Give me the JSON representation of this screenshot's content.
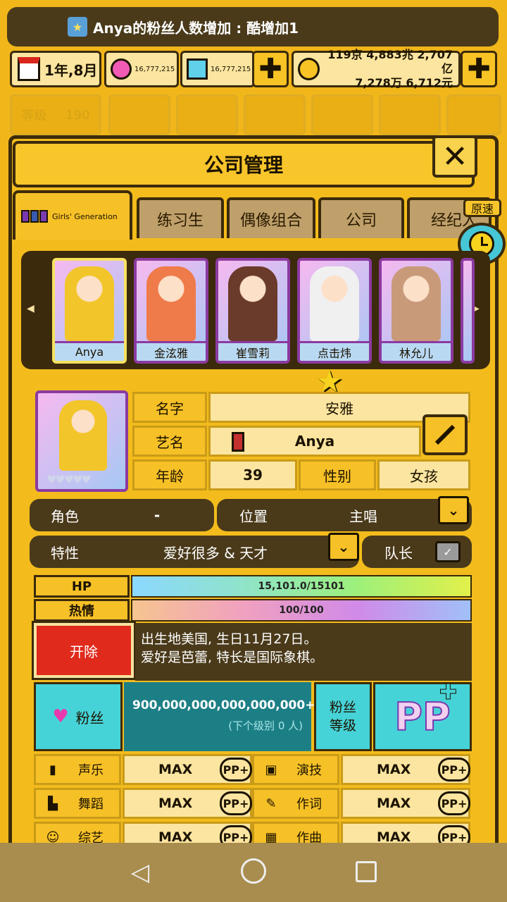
{
  "notification": {
    "text": "Anya的粉丝人数增加 : 酷增加1"
  },
  "status": {
    "date": "1年,8月",
    "pink_gems": "16,777,215",
    "blue_gems": "16,777,215",
    "money_line1": "119京 4,883兆 2,707亿",
    "money_line2": "7,278万 6,712元"
  },
  "background_menu": {
    "level_label": "等级",
    "level_value": "190"
  },
  "window": {
    "title": "公司管理"
  },
  "tabs": {
    "group_name": "Girls' Generation",
    "items": [
      "练习生",
      "偶像组合",
      "公司",
      "经纪人"
    ]
  },
  "speed": {
    "label": "原速"
  },
  "members": [
    {
      "name": "Anya",
      "hair": "#f2c52a",
      "outfit": "#f79a3a"
    },
    {
      "name": "金泫雅",
      "hair": "#ef7a4a",
      "outfit": "#f6d6c0"
    },
    {
      "name": "崔雪莉",
      "hair": "#6a3a2a",
      "outfit": "#d64a7a"
    },
    {
      "name": "点击",
      "hair": "#f0f0f0",
      "outfit": "#222222",
      "name_suffix": "炜"
    },
    {
      "name": "林允儿",
      "hair": "#c89a7a",
      "outfit": "#f2b6c8"
    }
  ],
  "profile": {
    "name_label": "名字",
    "name_value": "安雅",
    "stage_label": "艺名",
    "stage_value": "Anya",
    "age_label": "年龄",
    "age_value": "39",
    "gender_label": "性别",
    "gender_value": "女孩",
    "role_label": "角色",
    "role_value": "-",
    "position_label": "位置",
    "position_value": "主唱",
    "trait_label": "特性",
    "trait_value": "爱好很多 & 天才",
    "leader_label": "队长"
  },
  "bars": {
    "hp_label": "HP",
    "hp_text": "15,101.0/15101",
    "hp_fraction": 1.0,
    "passion_label": "热情",
    "passion_text": "100/100",
    "passion_fraction": 1.0
  },
  "fire_button": "开除",
  "bio": {
    "line1": "出生地美国, 生日11月27日。",
    "line2": "爱好是芭蕾, 特长是国际象棋。"
  },
  "fans": {
    "label": "粉丝",
    "count": "900,000,000,000,000,000+ 人",
    "next": "(下个级别 0 人)",
    "level_label": "粉丝\n等级"
  },
  "skills": [
    {
      "name": "声乐",
      "value": "MAX",
      "pp": "PP+"
    },
    {
      "name": "演技",
      "value": "MAX",
      "pp": "PP+"
    },
    {
      "name": "舞蹈",
      "value": "MAX",
      "pp": "PP+"
    },
    {
      "name": "作词",
      "value": "MAX",
      "pp": "PP+"
    },
    {
      "name": "综艺",
      "value": "MAX",
      "pp": "PP+"
    },
    {
      "name": "作曲",
      "value": "MAX",
      "pp": "PP+"
    }
  ],
  "colors": {
    "panel": "#f3bc1c",
    "dark": "#3b2a0c",
    "fire": "#d9261c",
    "teal": "#1d7f86"
  }
}
